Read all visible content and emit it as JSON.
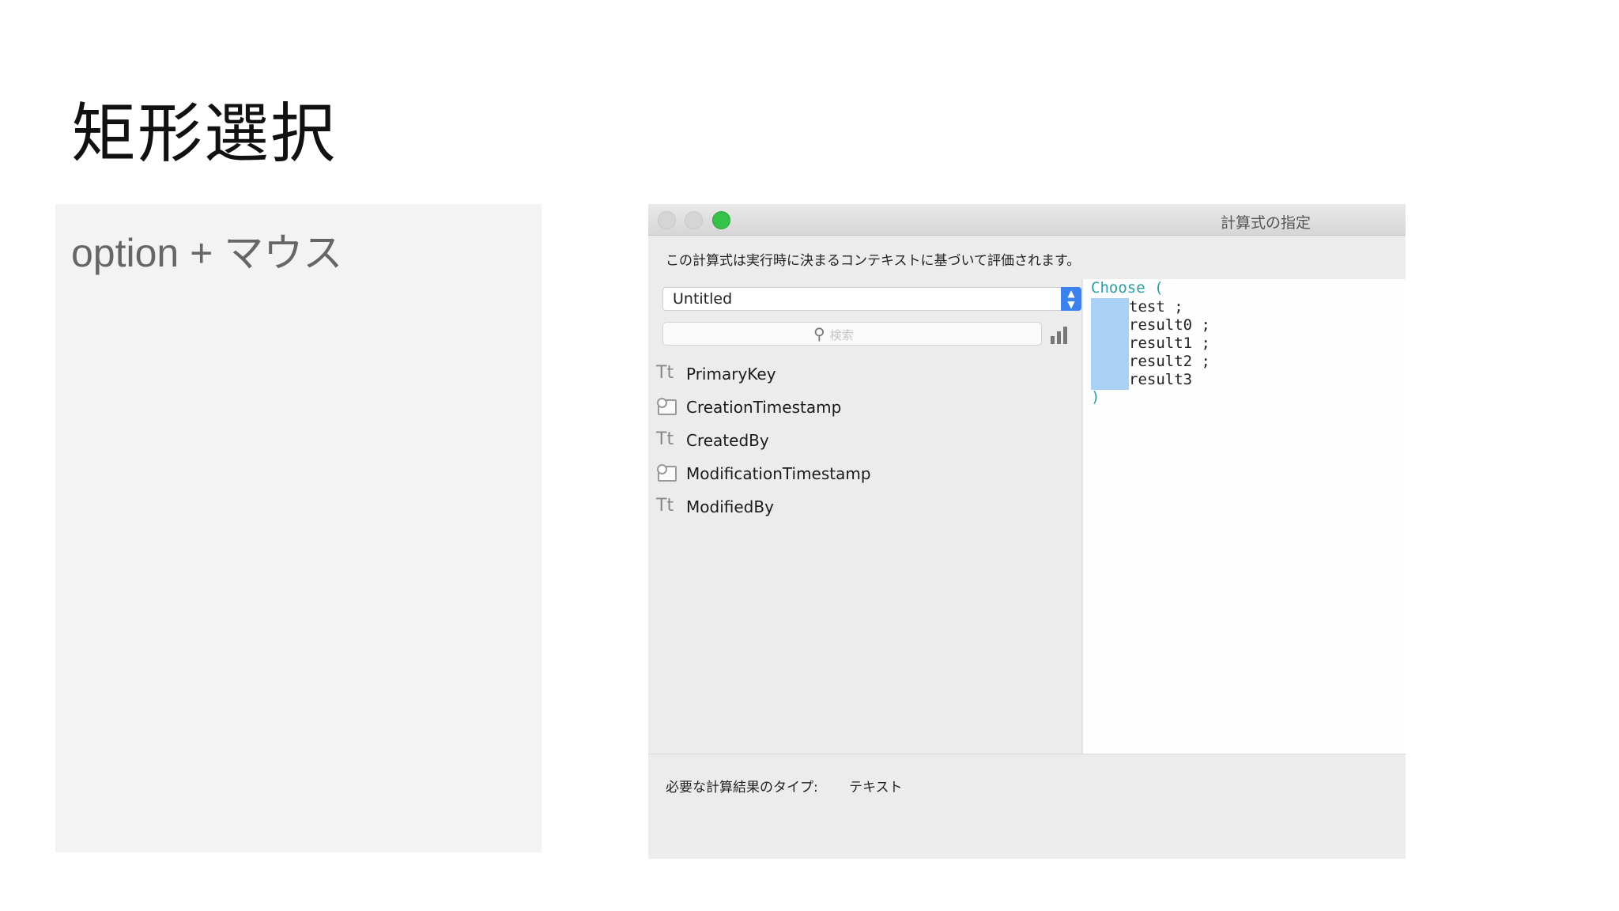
{
  "slide": {
    "title": "矩形選択",
    "note": "option + マウス"
  },
  "window": {
    "title": "計算式の指定",
    "description": "この計算式は実行時に決まるコンテキストに基づいて評価されます。",
    "table_selector": "Untitled",
    "search_placeholder": "検索",
    "fields": [
      {
        "label": "PrimaryKey",
        "icon": "text-field-icon"
      },
      {
        "label": "CreationTimestamp",
        "icon": "timestamp-field-icon"
      },
      {
        "label": "CreatedBy",
        "icon": "text-field-icon"
      },
      {
        "label": "ModificationTimestamp",
        "icon": "timestamp-field-icon"
      },
      {
        "label": "ModifiedBy",
        "icon": "text-field-icon"
      }
    ],
    "editor": {
      "open": "Choose (",
      "lines": [
        "test ;",
        "result0 ;",
        "result1 ;",
        "result2 ;",
        "result3"
      ],
      "close": ")"
    },
    "result_type_label": "必要な計算結果のタイプ:",
    "result_type_value": "テキスト"
  },
  "colors": {
    "traffic_green": "#34c24a",
    "selection": "#a9d0f5",
    "keyword": "#2a9ea6",
    "popup_accent": "#3b82f0"
  }
}
